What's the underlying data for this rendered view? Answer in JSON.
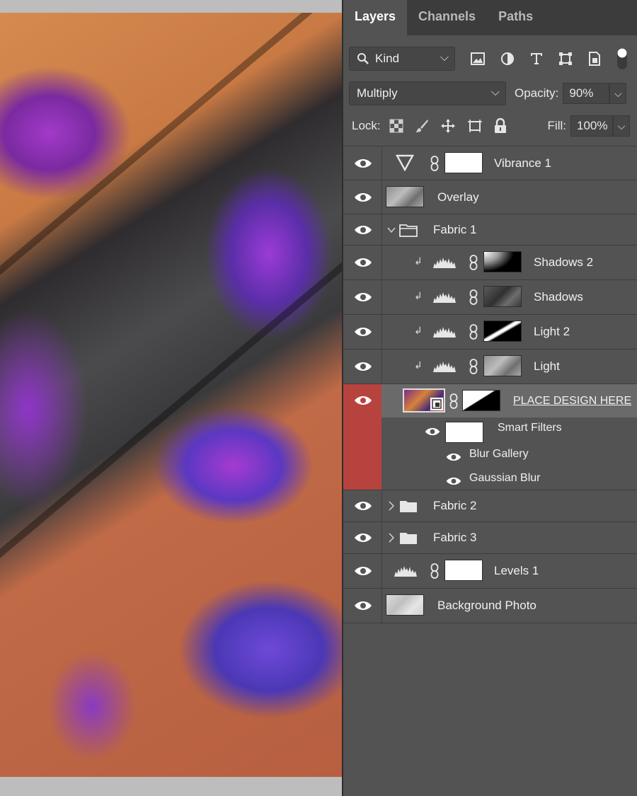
{
  "tabs": [
    {
      "label": "Layers",
      "active": true
    },
    {
      "label": "Channels",
      "active": false
    },
    {
      "label": "Paths",
      "active": false
    }
  ],
  "filter": {
    "kind_label": "Kind",
    "icons": [
      "image-filter-icon",
      "adjustment-filter-icon",
      "type-filter-icon",
      "shape-filter-icon",
      "smart-object-filter-icon",
      "filter-toggle-icon"
    ]
  },
  "blend": {
    "mode": "Multiply",
    "opacity_label": "Opacity:",
    "opacity_value": "90%"
  },
  "lock": {
    "label": "Lock:",
    "icons": [
      "lock-transparent-icon",
      "lock-paint-icon",
      "lock-position-icon",
      "lock-artboard-icon",
      "lock-all-icon"
    ],
    "fill_label": "Fill:",
    "fill_value": "100%"
  },
  "layers": {
    "vibrance": "Vibrance 1",
    "overlay": "Overlay",
    "fabric1": "Fabric 1",
    "shadows2": "Shadows 2",
    "shadows": "Shadows",
    "light2": "Light 2",
    "light": "Light",
    "place_design": "PLACE DESIGN HERE",
    "smart_filters": "Smart Filters",
    "blur_gallery": "Blur Gallery",
    "gaussian_blur": "Gaussian Blur",
    "fabric2": "Fabric 2",
    "fabric3": "Fabric 3",
    "levels1": "Levels 1",
    "background": "Background Photo"
  },
  "colors": {
    "panel": "#535353",
    "tabbar": "#3c3c3c",
    "selected": "#6a6a6a",
    "selection_marker": "#b7433f"
  }
}
